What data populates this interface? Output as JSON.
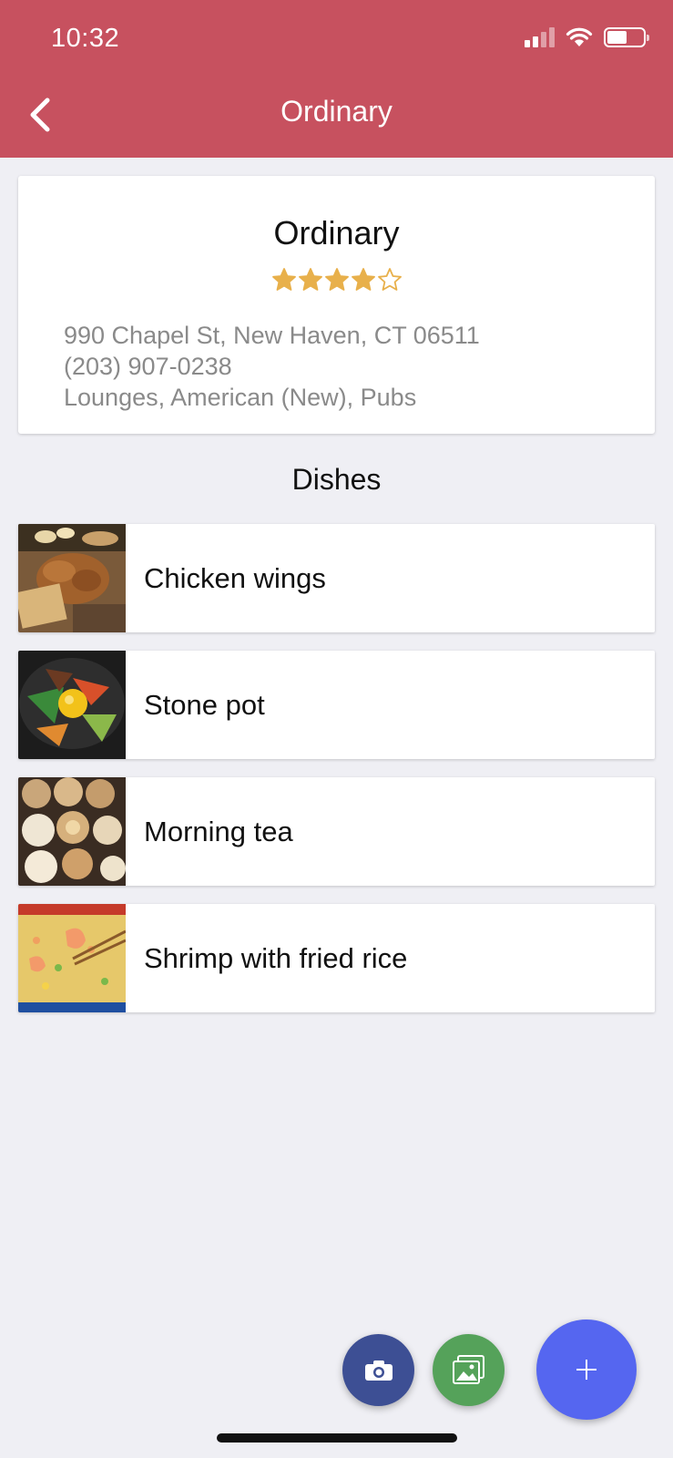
{
  "status_bar": {
    "time": "10:32"
  },
  "nav": {
    "title": "Ordinary"
  },
  "restaurant": {
    "name": "Ordinary",
    "rating": 4,
    "rating_max": 5,
    "address": "990 Chapel St, New Haven, CT 06511",
    "phone": "(203) 907-0238",
    "categories": "Lounges, American (New), Pubs"
  },
  "dishes_section": {
    "title": "Dishes"
  },
  "dishes": [
    {
      "name": "Chicken wings",
      "image": "chicken-wings-photo"
    },
    {
      "name": "Stone pot",
      "image": "stone-pot-photo"
    },
    {
      "name": "Morning tea",
      "image": "morning-tea-photo"
    },
    {
      "name": "Shrimp with fried rice",
      "image": "shrimp-fried-rice-photo"
    }
  ],
  "actions": {
    "camera_icon": "camera-icon",
    "gallery_icon": "gallery-icon",
    "add_icon": "plus-icon"
  },
  "colors": {
    "header": "#c7515f",
    "star": "#e8b04b",
    "camera_fab": "#3d4f94",
    "gallery_fab": "#55a25a",
    "add_fab": "#5566f0"
  }
}
